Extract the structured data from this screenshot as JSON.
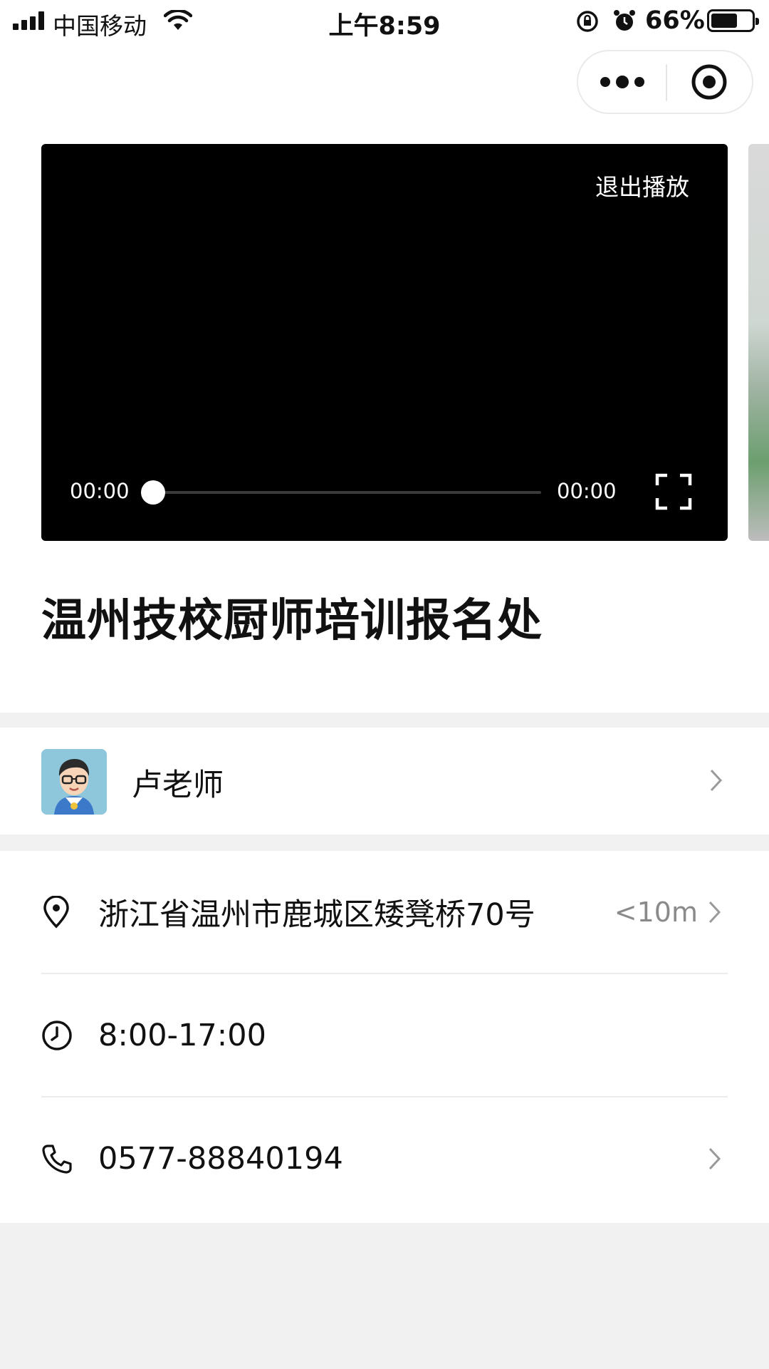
{
  "status_bar": {
    "carrier": "中国移动",
    "time": "上午8:59",
    "battery_percent": "66%",
    "battery_level": 0.66
  },
  "video": {
    "exit_label": "退出播放",
    "current_time": "00:00",
    "duration": "00:00",
    "progress": 0
  },
  "title": "温州技校厨师培训报名处",
  "teacher": {
    "name": "卢老师"
  },
  "info": {
    "address": "浙江省温州市鹿城区矮凳桥70号",
    "distance": "<10m",
    "hours": "8:00-17:00",
    "phone": "0577-88840194"
  },
  "icons": {
    "more": "more-icon",
    "close": "close-miniprogram-icon",
    "fullscreen": "fullscreen-icon",
    "location": "location-pin-icon",
    "clock": "clock-icon",
    "phone": "phone-icon",
    "chevron": "chevron-right-icon"
  }
}
